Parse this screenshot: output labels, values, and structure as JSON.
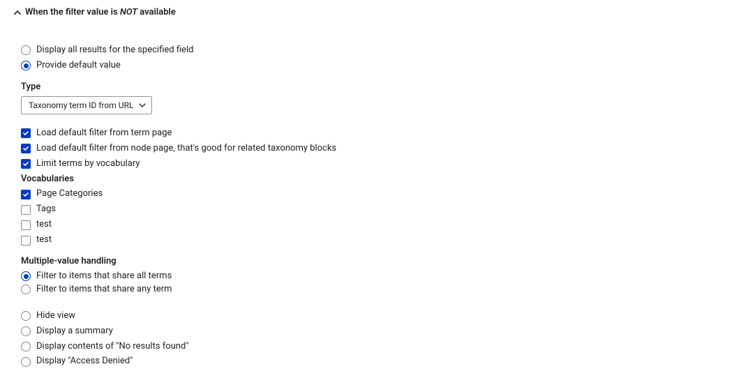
{
  "section": {
    "title_prefix": "When the filter value is ",
    "title_not": "NOT",
    "title_suffix": " available"
  },
  "topRadios": {
    "displayAll": "Display all results for the specified field",
    "provideDefault": "Provide default value"
  },
  "typeField": {
    "label": "Type",
    "value": "Taxonomy term ID from URL"
  },
  "checks": {
    "loadTermPage": "Load default filter from term page",
    "loadNodePage": "Load default filter from node page, that's good for related taxonomy blocks",
    "limitVocab": "Limit terms by vocabulary"
  },
  "vocabSection": {
    "label": "Vocabularies",
    "items": [
      {
        "label": "Page Categories",
        "checked": true
      },
      {
        "label": "Tags",
        "checked": false
      },
      {
        "label": "test",
        "checked": false
      },
      {
        "label": "test",
        "checked": false
      }
    ]
  },
  "multiValue": {
    "label": "Multiple-value handling",
    "allTerms": "Filter to items that share all terms",
    "anyTerm": "Filter to items that share any term"
  },
  "bottomRadios": {
    "hideView": "Hide view",
    "displaySummary": "Display a summary",
    "noResults": "Display contents of \"No results found\"",
    "accessDenied": "Display \"Access Denied\""
  }
}
